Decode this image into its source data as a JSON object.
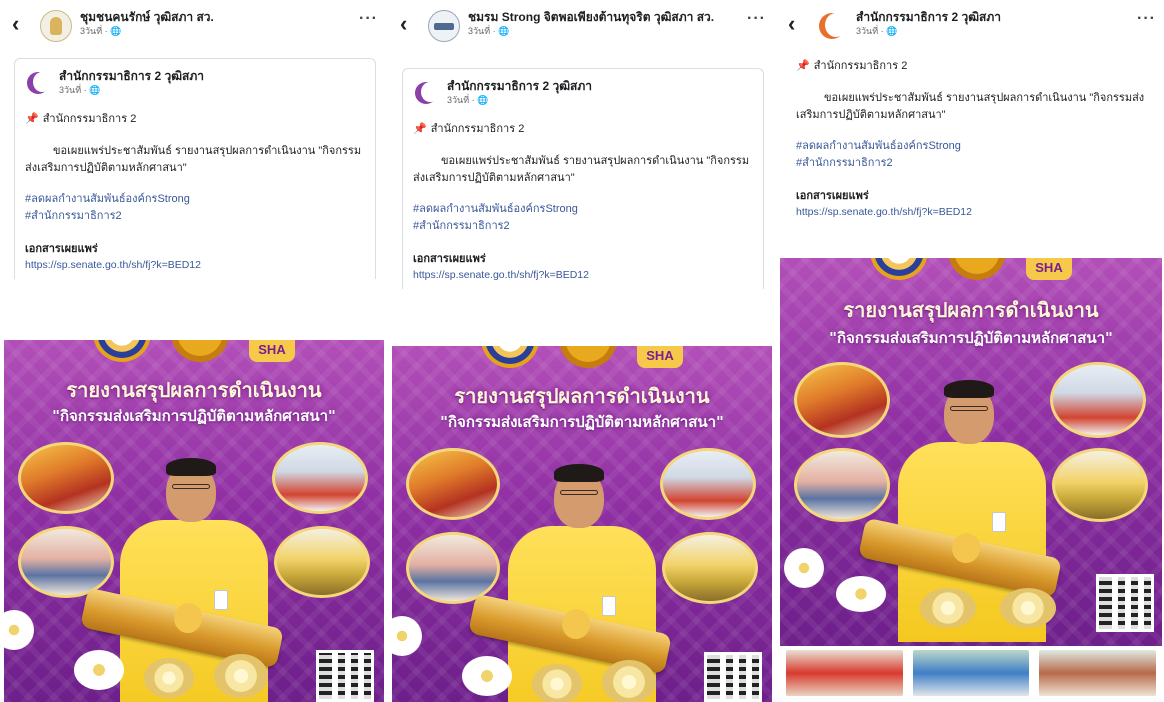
{
  "panels": [
    {
      "header": {
        "name": "ชุมชนคนรักษ์ วุฒิสภา สว.",
        "time": "3วันที่ · 🌐",
        "avatar_icon": "emblem-icon"
      },
      "shared_post": {
        "author": "สำนักกรรมาธิการ 2 วุฒิสภา",
        "time": "3วันที่ · 🌐",
        "pin_text": "สำนักกรรมาธิการ 2",
        "body": "ขอเผยแพร่ประชาสัมพันธ์ รายงานสรุปผลการดำเนินงาน \"กิจกรรมส่งเสริมการปฏิบัติตามหลักศาสนา\"",
        "tags": [
          "#ลดผลกำงานสัมพันธ์องค์กรStrong",
          "#สำนักกรรมาธิการ2"
        ],
        "doc_label": "เอกสารเผยแพร่",
        "doc_link": "https://sp.senate.go.th/sh/fj?k=BED12"
      },
      "poster": {
        "title": "รายงานสรุปผลการดำเนินงาน",
        "subtitle": "\"กิจกรรมส่งเสริมการปฏิบัติตามหลักศาสนา\"",
        "badge": "SHA"
      }
    },
    {
      "header": {
        "name": "ชมรม Strong จิตพอเพียงต้านทุจริต วุฒิสภา สว.",
        "time": "3วันที่ · 🌐",
        "avatar_icon": "club-logo-icon"
      },
      "shared_post": {
        "author": "สำนักกรรมาธิการ 2 วุฒิสภา",
        "time": "3วันที่ · 🌐",
        "pin_text": "สำนักกรรมาธิการ 2",
        "body": "ขอเผยแพร่ประชาสัมพันธ์ รายงานสรุปผลการดำเนินงาน \"กิจกรรมส่งเสริมการปฏิบัติตามหลักศาสนา\"",
        "tags": [
          "#ลดผลกำงานสัมพันธ์องค์กรStrong",
          "#สำนักกรรมาธิการ2"
        ],
        "doc_label": "เอกสารเผยแพร่",
        "doc_link": "https://sp.senate.go.th/sh/fj?k=BED12"
      },
      "poster": {
        "title": "รายงานสรุปผลการดำเนินงาน",
        "subtitle": "\"กิจกรรมส่งเสริมการปฏิบัติตามหลักศาสนา\"",
        "badge": "SHA"
      }
    },
    {
      "header": {
        "name": "สำนักกรรมาธิการ 2 วุฒิสภา",
        "time": "3วันที่ · 🌐",
        "avatar_icon": "crescent-logo-icon"
      },
      "post": {
        "pin_text": "สำนักกรรมาธิการ 2",
        "body": "ขอเผยแพร่ประชาสัมพันธ์ รายงานสรุปผลการดำเนินงาน \"กิจกรรมส่งเสริมการปฏิบัติตามหลักศาสนา\"",
        "tags": [
          "#ลดผลกำงานสัมพันธ์องค์กรStrong",
          "#สำนักกรรมาธิการ2"
        ],
        "doc_label": "เอกสารเผยแพร่",
        "doc_link": "https://sp.senate.go.th/sh/fj?k=BED12"
      },
      "poster": {
        "title": "รายงานสรุปผลการดำเนินงาน",
        "subtitle": "\"กิจกรรมส่งเสริมการปฏิบัติตามหลักศาสนา\"",
        "badge": "SHA"
      }
    }
  ],
  "ui": {
    "back_glyph": "‹",
    "more_glyph": "···",
    "pin_glyph": "📌"
  },
  "colors": {
    "link": "#385898",
    "poster_purple": "#8f2fa3",
    "gold": "#f4c81f"
  }
}
